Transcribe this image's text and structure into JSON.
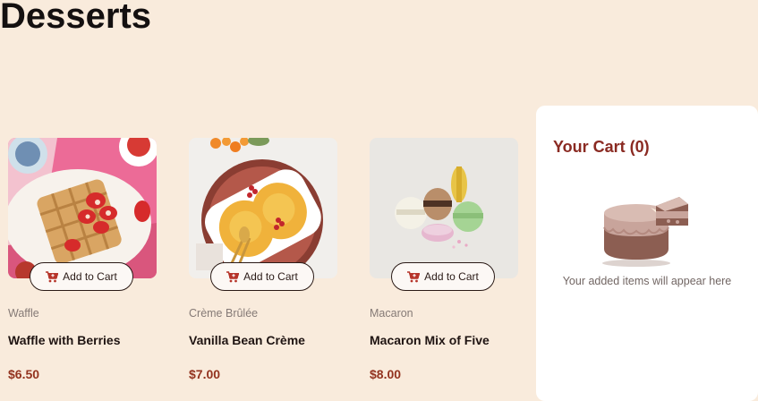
{
  "page": {
    "title": "Desserts"
  },
  "products": [
    {
      "category": "Waffle",
      "name": "Waffle with Berries",
      "price": "$6.50",
      "button_label": "Add to Cart",
      "image": "waffle-with-berries-photo"
    },
    {
      "category": "Crème Brûlée",
      "name": "Vanilla Bean Crème",
      "price": "$7.00",
      "button_label": "Add to Cart",
      "image": "creme-brulee-photo"
    },
    {
      "category": "Macaron",
      "name": "Macaron Mix of Five",
      "price": "$8.00",
      "button_label": "Add to Cart",
      "image": "macaron-mix-photo"
    }
  ],
  "cart": {
    "title": "Your Cart (0)",
    "empty_text": "Your added items will appear here",
    "illustration": "empty-cart-cake-icon"
  },
  "icons": {
    "add_to_cart": "cart-plus-icon"
  },
  "colors": {
    "background": "#f9ebdc",
    "accent": "#8a2a22",
    "price": "#93331f"
  }
}
